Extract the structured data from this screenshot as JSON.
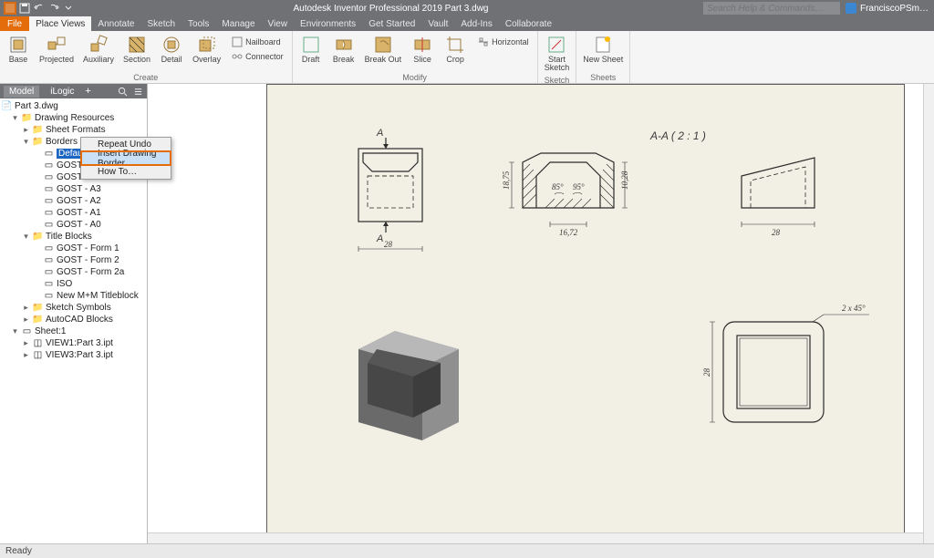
{
  "app": {
    "title": "Autodesk Inventor Professional 2019   Part 3.dwg",
    "search_placeholder": "Search Help & Commands…",
    "user": "FranciscoPSm…"
  },
  "tabs": {
    "file": "File",
    "items": [
      "Place Views",
      "Annotate",
      "Sketch",
      "Tools",
      "Manage",
      "View",
      "Environments",
      "Get Started",
      "Vault",
      "Add-Ins",
      "Collaborate"
    ],
    "active": "Place Views"
  },
  "ribbon": {
    "create": {
      "label": "Create",
      "base": "Base",
      "projected": "Projected",
      "auxiliary": "Auxiliary",
      "section": "Section",
      "detail": "Detail",
      "overlay": "Overlay",
      "nailboard": "Nailboard",
      "connector": "Connector"
    },
    "modify": {
      "label": "Modify",
      "draft": "Draft",
      "break": "Break",
      "breakout": "Break Out",
      "slice": "Slice",
      "crop": "Crop",
      "horizontal": "Horizontal"
    },
    "sketch": {
      "label": "Sketch",
      "start": "Start\nSketch"
    },
    "sheets": {
      "label": "Sheets",
      "new": "New Sheet"
    }
  },
  "browser": {
    "tabs": {
      "model": "Model",
      "ilogic": "iLogic"
    },
    "root": "Part 3.dwg",
    "drawres": "Drawing Resources",
    "sheetfmt": "Sheet Formats",
    "borders": "Borders",
    "border_items": [
      "Default Border",
      "GOST - Border",
      "GOST - A4",
      "GOST - A3",
      "GOST - A2",
      "GOST - A1",
      "GOST - A0"
    ],
    "titleblocks": "Title Blocks",
    "tb_items": [
      "GOST - Form 1",
      "GOST - Form 2",
      "GOST - Form 2a",
      "ISO",
      "New M+M Titleblock"
    ],
    "sketchsym": "Sketch Symbols",
    "acadblocks": "AutoCAD Blocks",
    "sheet1": "Sheet:1",
    "views": [
      "VIEW1:Part 3.ipt",
      "VIEW3:Part 3.ipt"
    ]
  },
  "context_menu": {
    "repeat": "Repeat Undo",
    "insert": "Insert Drawing Border…",
    "howto": "How To…"
  },
  "drawing": {
    "sectlabel": "A-A ( 2 : 1 )",
    "dim_w": "28",
    "dim_w2": "28",
    "dim_h": "18,75",
    "dim_hh": "10,28",
    "dim_bot": "16,72",
    "ang1": "85°",
    "ang2": "95°",
    "chamf": "2 x 45°",
    "arrA": "A",
    "dim_side": "28"
  },
  "status": {
    "ready": "Ready"
  }
}
